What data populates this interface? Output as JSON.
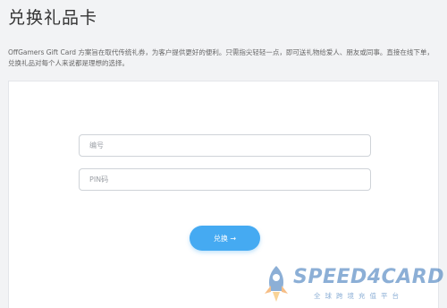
{
  "page": {
    "title": "兑换礼品卡",
    "intro": "OffGamers Gift Card 方案旨在取代传统礼券，为客户提供更好的便利。只需指尖轻轻一点，即可送礼物给爱人、朋友或同事。直接在线下单，兑换礼品对每个人来说都是理想的选择。"
  },
  "form": {
    "code_placeholder": "编号",
    "pin_placeholder": "PIN码",
    "code_value": "",
    "pin_value": "",
    "redeem_label": "兑换 →"
  },
  "watermark": {
    "brand": "SPEED4CARD",
    "tagline": "全球跨境充值平台",
    "icon": "rocket-icon"
  },
  "colors": {
    "accent": "#45aaf2",
    "background": "#f2f3f5",
    "watermark": "#2f6fb5"
  }
}
